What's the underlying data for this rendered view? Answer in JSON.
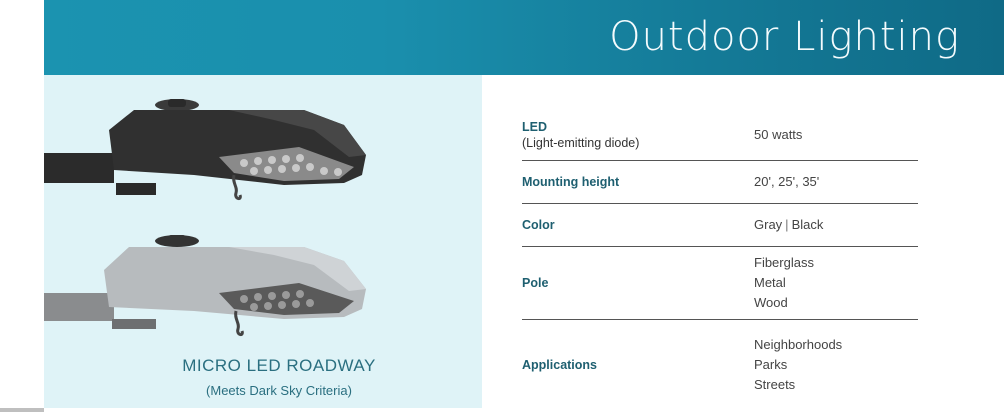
{
  "banner": {
    "title": "Outdoor Lighting"
  },
  "product": {
    "name": "MICRO LED ROADWAY",
    "note": "(Meets Dark Sky Criteria)",
    "image_alt": "Two LED roadway light fixtures, one black and one gray"
  },
  "specs": {
    "led": {
      "label": "LED",
      "sublabel": "(Light-emitting diode)",
      "value": "50 watts"
    },
    "mounting": {
      "label": "Mounting height",
      "value": "20', 25', 35'"
    },
    "color": {
      "label": "Color",
      "values": [
        "Gray",
        "Black"
      ],
      "separator": "|"
    },
    "pole": {
      "label": "Pole",
      "values": [
        "Fiberglass",
        "Metal",
        "Wood"
      ]
    },
    "applications": {
      "label": "Applications",
      "values": [
        "Neighborhoods",
        "Parks",
        "Streets"
      ]
    }
  },
  "colors": {
    "banner": "#1a8fad",
    "photo_bg": "#dff3f7",
    "label_text": "#1e5f70"
  }
}
